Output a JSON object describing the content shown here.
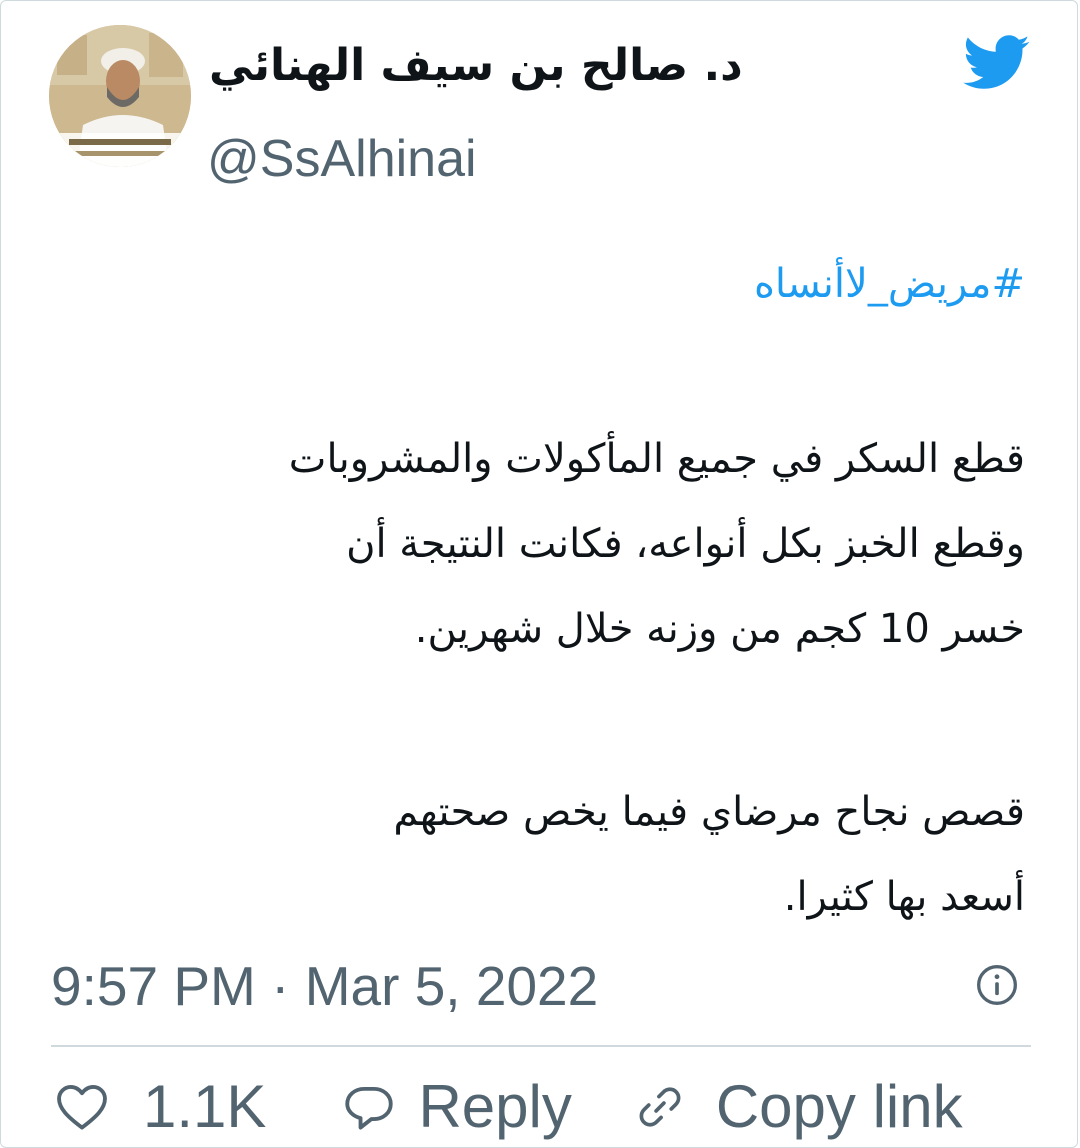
{
  "tweet": {
    "author": {
      "display_name": "د. صالح بن سيف الهنائي",
      "handle": "@SsAlhinai"
    },
    "hashtag": "#مريض_لاأنساه",
    "paragraph_1": [
      "قطع السكر في جميع المأكولات والمشروبات",
      "وقطع الخبز بكل أنواعه، فكانت النتيجة أن",
      "خسر 10 كجم من وزنه خلال شهرين."
    ],
    "paragraph_2": [
      "قصص نجاح مرضاي فيما يخص صحتهم",
      "أسعد بها كثيرا."
    ],
    "timestamp": "9:57 PM · Mar 5, 2022"
  },
  "actions": {
    "like_count": "1.1K",
    "reply_label": "Reply",
    "copy_link_label": "Copy link"
  },
  "icons": {
    "brand": "twitter-bird-icon",
    "info": "info-icon",
    "like": "heart-icon",
    "reply": "speech-bubble-icon",
    "link": "link-icon"
  },
  "colors": {
    "twitter_blue": "#1d9bf0",
    "text_primary": "#0f1419",
    "text_secondary": "#536471",
    "divider": "#cfd9de"
  }
}
